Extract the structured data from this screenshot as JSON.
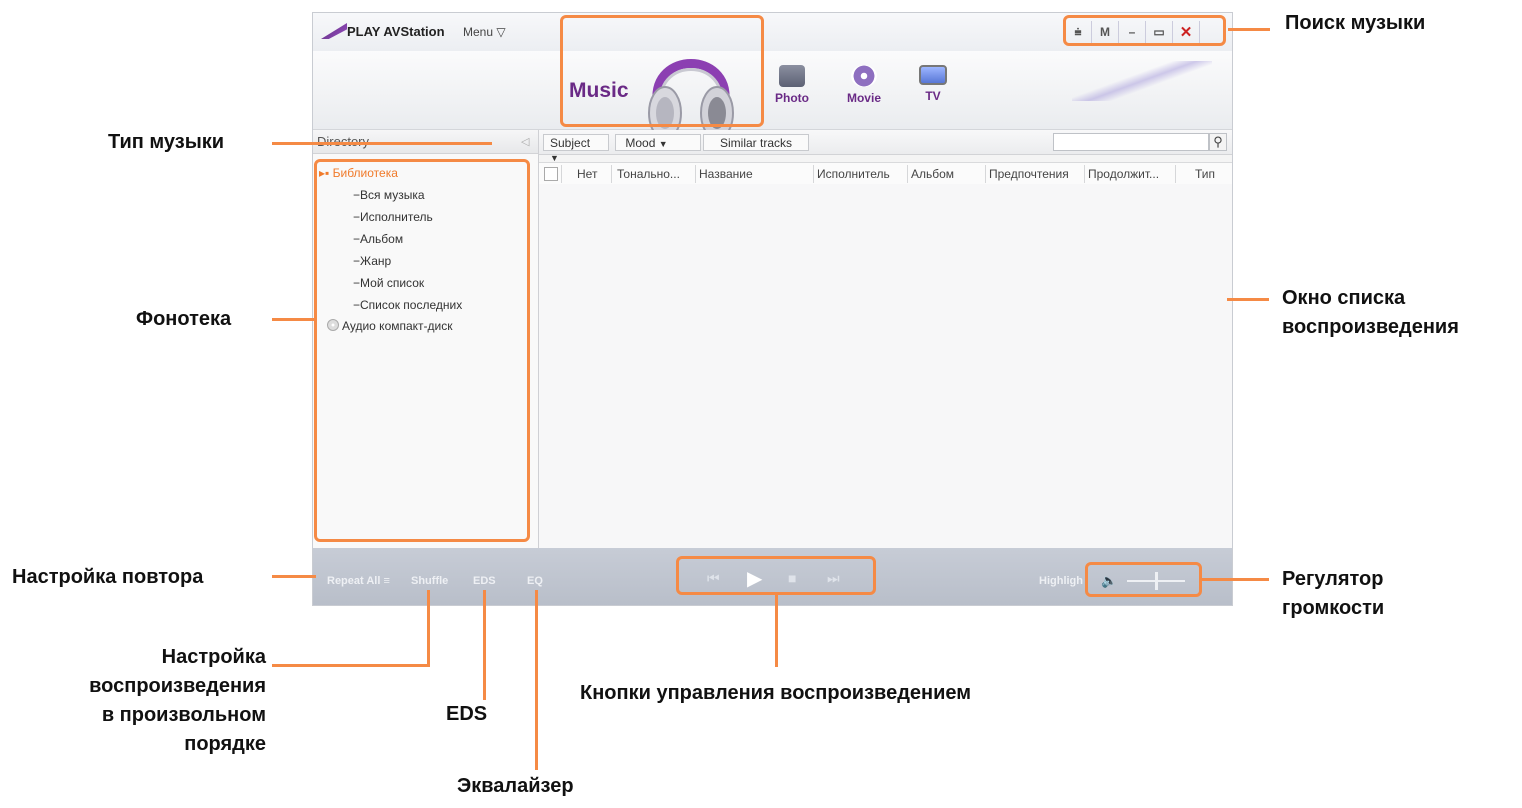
{
  "app": {
    "title": "PLAY AVStation",
    "menu_label": "Menu ▽",
    "window_controls": [
      "⩧",
      "M",
      "–",
      "▭",
      "✕"
    ],
    "hero_label": "Music",
    "nav_items": [
      {
        "label": "Photo",
        "icon": "camera-icon"
      },
      {
        "label": "Movie",
        "icon": "film-reel-icon"
      },
      {
        "label": "TV",
        "icon": "tv-icon"
      }
    ]
  },
  "left_panel": {
    "header": "Directory",
    "collapse_arrow": "◁",
    "root": "Библиотека",
    "items": [
      "Вся музыка",
      "Исполнитель",
      "Альбом",
      "Жанр",
      "Мой список",
      "Список последних"
    ],
    "audio_cd": "Аудио компакт-диск"
  },
  "toolbar": {
    "subject": "Subject",
    "mood": "Mood",
    "similar": "Similar tracks",
    "search_value": "",
    "search_icon": "magnifier-icon"
  },
  "table": {
    "columns": [
      "Нет",
      "Тонально...",
      "Название",
      "Исполнитель",
      "Альбом",
      "Предпочтения",
      "Продолжит...",
      "Тип"
    ]
  },
  "player": {
    "repeat": "Repeat All",
    "shuffle": "Shuffle",
    "eds": "EDS",
    "eq": "EQ",
    "highlight": "Highligh",
    "controls": [
      "previous-icon",
      "play-icon",
      "stop-icon",
      "next-icon"
    ]
  },
  "callouts": {
    "search_music": "Поиск музыки",
    "music_type": "Тип музыки",
    "library": "Фонотека",
    "playlist_window_1": "Окно списка",
    "playlist_window_2": "воспроизведения",
    "repeat_setting": "Настройка повтора",
    "shuffle_1": "Настройка",
    "shuffle_2": "воспроизведения",
    "shuffle_3": "в произвольном",
    "shuffle_4": "порядке",
    "eds": "EDS",
    "playback_buttons": "Кнопки управления воспроизведением",
    "volume_1": "Регулятор",
    "volume_2": "громкости",
    "equalizer": "Эквалайзер"
  },
  "colors": {
    "accent_orange": "#f58a45",
    "brand_purple": "#6a2a86",
    "player_bar": "#c0c5cf"
  }
}
